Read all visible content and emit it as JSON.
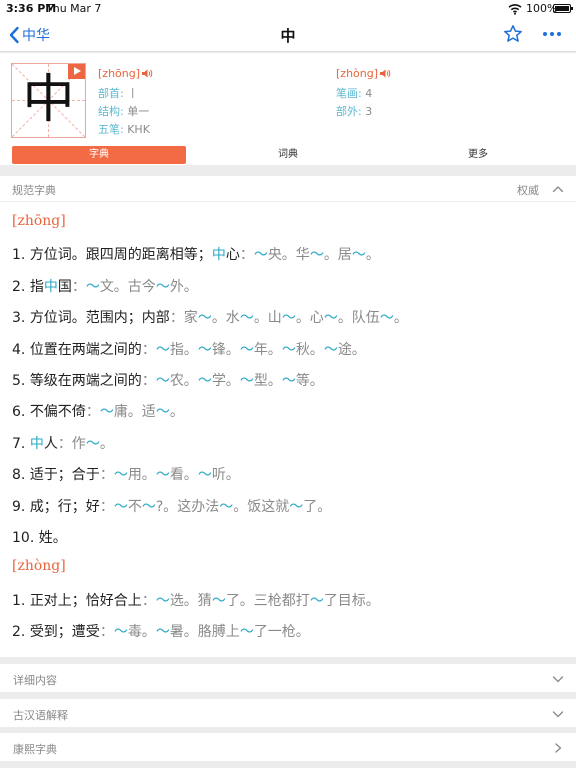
{
  "status_bar": {
    "time": "3:36 PM",
    "date": "Thu Mar 7",
    "battery": "100%"
  },
  "nav": {
    "back_label": "中华",
    "title": "中"
  },
  "character": {
    "glyph": "中",
    "pinyin_1": "[zhōng]",
    "pinyin_2": "[zhòng]",
    "radical_label": "部首:",
    "radical_value": "丨",
    "structure_label": "结构:",
    "structure_value": "单一",
    "wubi_label": "五笔:",
    "wubi_value": "KHK",
    "strokes_label": "笔画:",
    "strokes_value": "4",
    "extra_label": "部外:",
    "extra_value": "3"
  },
  "tabs": [
    {
      "label": "字典",
      "active": true
    },
    {
      "label": "词典",
      "active": false
    },
    {
      "label": "更多",
      "active": false
    }
  ],
  "section": {
    "title": "规范字典",
    "tag": "权威"
  },
  "readings": [
    {
      "pinyin": "[zhōng]",
      "definitions": [
        {
          "n": "1.",
          "parts": [
            [
              "t",
              "方位词。跟四周的距离相等；"
            ],
            [
              "h",
              "中"
            ],
            [
              "t",
              "心"
            ],
            [
              "e",
              "："
            ],
            [
              "x",
              "～"
            ],
            [
              "e",
              "央。华"
            ],
            [
              "x",
              "～"
            ],
            [
              "e",
              "。居"
            ],
            [
              "x",
              "～"
            ],
            [
              "e",
              "。"
            ]
          ]
        },
        {
          "n": "2.",
          "parts": [
            [
              "t",
              "指"
            ],
            [
              "h",
              "中"
            ],
            [
              "t",
              "国"
            ],
            [
              "e",
              "："
            ],
            [
              "x",
              "～"
            ],
            [
              "e",
              "文。古今"
            ],
            [
              "x",
              "～"
            ],
            [
              "e",
              "外。"
            ]
          ]
        },
        {
          "n": "3.",
          "parts": [
            [
              "t",
              "方位词。范围内；内部"
            ],
            [
              "e",
              "：家"
            ],
            [
              "x",
              "～"
            ],
            [
              "e",
              "。水"
            ],
            [
              "x",
              "～"
            ],
            [
              "e",
              "。山"
            ],
            [
              "x",
              "～"
            ],
            [
              "e",
              "。心"
            ],
            [
              "x",
              "～"
            ],
            [
              "e",
              "。队伍"
            ],
            [
              "x",
              "～"
            ],
            [
              "e",
              "。"
            ]
          ]
        },
        {
          "n": "4.",
          "parts": [
            [
              "t",
              "位置在两端之间的"
            ],
            [
              "e",
              "："
            ],
            [
              "x",
              "～"
            ],
            [
              "e",
              "指。"
            ],
            [
              "x",
              "～"
            ],
            [
              "e",
              "锋。"
            ],
            [
              "x",
              "～"
            ],
            [
              "e",
              "年。"
            ],
            [
              "x",
              "～"
            ],
            [
              "e",
              "秋。"
            ],
            [
              "x",
              "～"
            ],
            [
              "e",
              "途。"
            ]
          ]
        },
        {
          "n": "5.",
          "parts": [
            [
              "t",
              "等级在两端之间的"
            ],
            [
              "e",
              "："
            ],
            [
              "x",
              "～"
            ],
            [
              "e",
              "农。"
            ],
            [
              "x",
              "～"
            ],
            [
              "e",
              "学。"
            ],
            [
              "x",
              "～"
            ],
            [
              "e",
              "型。"
            ],
            [
              "x",
              "～"
            ],
            [
              "e",
              "等。"
            ]
          ]
        },
        {
          "n": "6.",
          "parts": [
            [
              "t",
              "不偏不倚"
            ],
            [
              "e",
              "："
            ],
            [
              "x",
              "～"
            ],
            [
              "e",
              "庸。适"
            ],
            [
              "x",
              "～"
            ],
            [
              "e",
              "。"
            ]
          ]
        },
        {
          "n": "7.",
          "parts": [
            [
              "h",
              "中"
            ],
            [
              "t",
              "人"
            ],
            [
              "e",
              "：作"
            ],
            [
              "x",
              "～"
            ],
            [
              "e",
              "。"
            ]
          ]
        },
        {
          "n": "8.",
          "parts": [
            [
              "t",
              "适于；合于"
            ],
            [
              "e",
              "："
            ],
            [
              "x",
              "～"
            ],
            [
              "e",
              "用。"
            ],
            [
              "x",
              "～"
            ],
            [
              "e",
              "看。"
            ],
            [
              "x",
              "～"
            ],
            [
              "e",
              "听。"
            ]
          ]
        },
        {
          "n": "9.",
          "parts": [
            [
              "t",
              "成；行；好"
            ],
            [
              "e",
              "："
            ],
            [
              "x",
              "～"
            ],
            [
              "e",
              "不"
            ],
            [
              "x",
              "～"
            ],
            [
              "e",
              "?。这办法"
            ],
            [
              "x",
              "～"
            ],
            [
              "e",
              "。饭这就"
            ],
            [
              "x",
              "～"
            ],
            [
              "e",
              "了。"
            ]
          ]
        },
        {
          "n": "10.",
          "parts": [
            [
              "t",
              "姓。"
            ]
          ]
        }
      ]
    },
    {
      "pinyin": "[zhòng]",
      "definitions": [
        {
          "n": "1.",
          "parts": [
            [
              "t",
              "正对上；恰好合上"
            ],
            [
              "e",
              "："
            ],
            [
              "x",
              "～"
            ],
            [
              "e",
              "选。猜"
            ],
            [
              "x",
              "～"
            ],
            [
              "e",
              "了。三枪都打"
            ],
            [
              "x",
              "～"
            ],
            [
              "e",
              "了目标。"
            ]
          ]
        },
        {
          "n": "2.",
          "parts": [
            [
              "t",
              "受到；遭受"
            ],
            [
              "e",
              "："
            ],
            [
              "x",
              "～"
            ],
            [
              "e",
              "毒。"
            ],
            [
              "x",
              "～"
            ],
            [
              "e",
              "暑。胳膊上"
            ],
            [
              "x",
              "～"
            ],
            [
              "e",
              "了一枪。"
            ]
          ]
        }
      ]
    }
  ],
  "collapsed_sections": [
    {
      "label": "详细内容"
    },
    {
      "label": "古汉语解释"
    },
    {
      "label": "康熙字典"
    }
  ],
  "colors": {
    "accent": "#f26b45",
    "pinyin": "#e8643c",
    "highlight": "#2aa9c9",
    "link": "#1e6fd9"
  }
}
